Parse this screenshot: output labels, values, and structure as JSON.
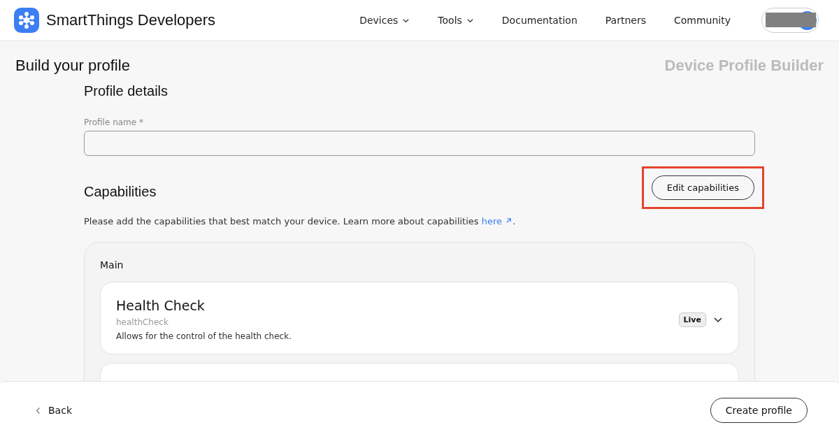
{
  "header": {
    "brand": "SmartThings Developers",
    "nav": [
      {
        "label": "Devices",
        "dropdown": true
      },
      {
        "label": "Tools",
        "dropdown": true
      },
      {
        "label": "Documentation",
        "dropdown": false
      },
      {
        "label": "Partners",
        "dropdown": false
      },
      {
        "label": "Community",
        "dropdown": false
      }
    ]
  },
  "page": {
    "title": "Build your profile",
    "subtitle": "Device Profile Builder"
  },
  "profile_details": {
    "heading": "Profile details",
    "field": {
      "label": "Profile name *"
    }
  },
  "capabilities": {
    "heading": "Capabilities",
    "edit_button": {
      "label": "Edit capabilities",
      "highlighted": true
    },
    "intro": "Please add the capabilities that best match your device. Learn more about capabilities ",
    "link": "here",
    "intro_end": ".",
    "component": {
      "title": "Main",
      "items": [
        {
          "name": "Health Check",
          "id": "healthCheck",
          "description": "Allows for the control of the health check.",
          "status": "Live",
          "expanded": false
        }
      ]
    }
  },
  "footer": {
    "back": "Back",
    "create": "Create profile"
  }
}
